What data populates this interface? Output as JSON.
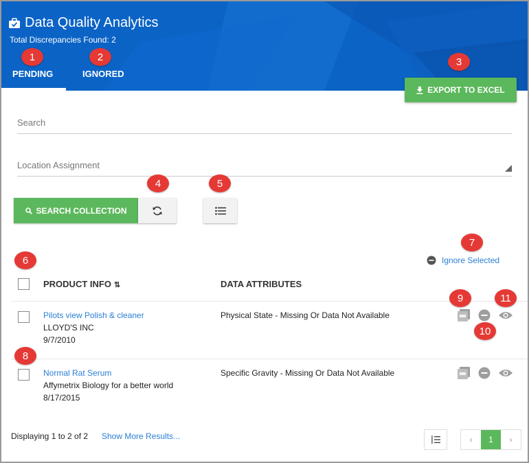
{
  "header": {
    "title": "Data Quality Analytics",
    "subtitle": "Total Discrepancies Found: 2",
    "tabs": [
      {
        "label": "PENDING"
      },
      {
        "label": "IGNORED"
      }
    ],
    "export_label": "EXPORT TO EXCEL",
    "colors": {
      "header_bg": "#0b63c6",
      "accent_green": "#5cb85c",
      "badge_red": "#e53935",
      "link_blue": "#2a7fd4"
    }
  },
  "filters": {
    "search_placeholder": "Search",
    "location_placeholder": "Location Assignment",
    "search_button_label": "SEARCH COLLECTION"
  },
  "actions": {
    "ignore_selected_label": "Ignore Selected"
  },
  "table": {
    "columns": [
      "PRODUCT INFO",
      "DATA ATTRIBUTES"
    ],
    "sort_glyph": "⇅",
    "rows": [
      {
        "product": "Pilots view Polish & cleaner",
        "company": "LLOYD'S INC",
        "date": "9/7/2010",
        "attribute": "Physical State - Missing Or Data Not Available"
      },
      {
        "product": "Normal Rat Serum",
        "company": "Affymetrix Biology for a better world",
        "date": "8/17/2015",
        "attribute": "Specific Gravity - Missing Or Data Not Available"
      }
    ]
  },
  "footer": {
    "displaying": "Displaying 1 to 2 of 2",
    "show_more": "Show More Results..."
  },
  "pagination": {
    "prev": "‹",
    "current": "1",
    "next": "›"
  },
  "badges": [
    "1",
    "2",
    "3",
    "4",
    "5",
    "6",
    "7",
    "8",
    "9",
    "10",
    "11"
  ]
}
